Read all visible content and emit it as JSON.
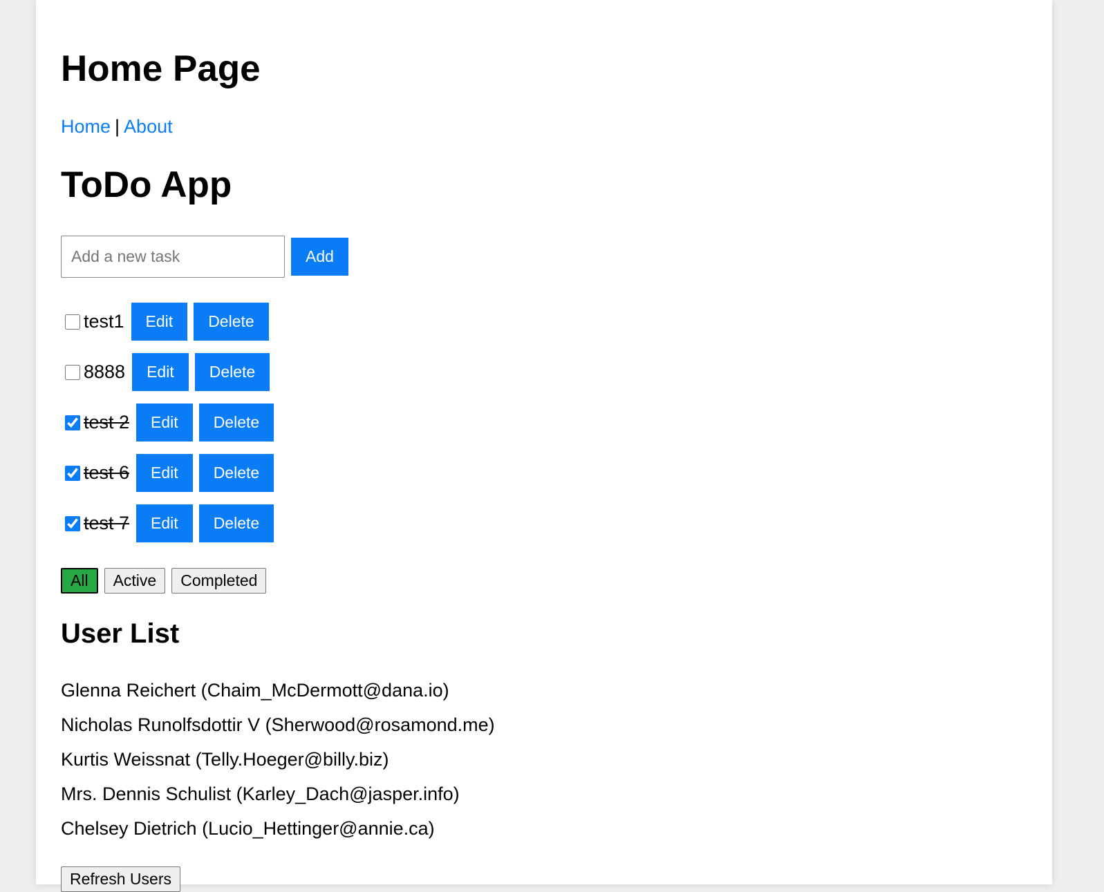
{
  "page": {
    "title": "Home Page"
  },
  "nav": {
    "home_label": "Home",
    "separator": "|",
    "about_label": "About"
  },
  "todo": {
    "title": "ToDo App",
    "input_placeholder": "Add a new task",
    "input_value": "",
    "add_label": "Add",
    "items": [
      {
        "text": "test1",
        "completed": false,
        "edit_label": "Edit",
        "delete_label": "Delete"
      },
      {
        "text": "8888",
        "completed": false,
        "edit_label": "Edit",
        "delete_label": "Delete"
      },
      {
        "text": "test 2",
        "completed": true,
        "edit_label": "Edit",
        "delete_label": "Delete"
      },
      {
        "text": "test 6",
        "completed": true,
        "edit_label": "Edit",
        "delete_label": "Delete"
      },
      {
        "text": "test 7",
        "completed": true,
        "edit_label": "Edit",
        "delete_label": "Delete"
      }
    ],
    "filters": [
      {
        "label": "All",
        "active": true
      },
      {
        "label": "Active",
        "active": false
      },
      {
        "label": "Completed",
        "active": false
      }
    ]
  },
  "users": {
    "title": "User List",
    "items": [
      "Glenna Reichert (Chaim_McDermott@dana.io)",
      "Nicholas Runolfsdottir V (Sherwood@rosamond.me)",
      "Kurtis Weissnat (Telly.Hoeger@billy.biz)",
      "Mrs. Dennis Schulist (Karley_Dach@jasper.info)",
      "Chelsey Dietrich (Lucio_Hettinger@annie.ca)"
    ],
    "refresh_label": "Refresh Users"
  },
  "colors": {
    "primary": "#0a7cf5",
    "filter_active": "#28a745",
    "page_background": "#ffffff",
    "outer_background": "#eeeeee"
  }
}
